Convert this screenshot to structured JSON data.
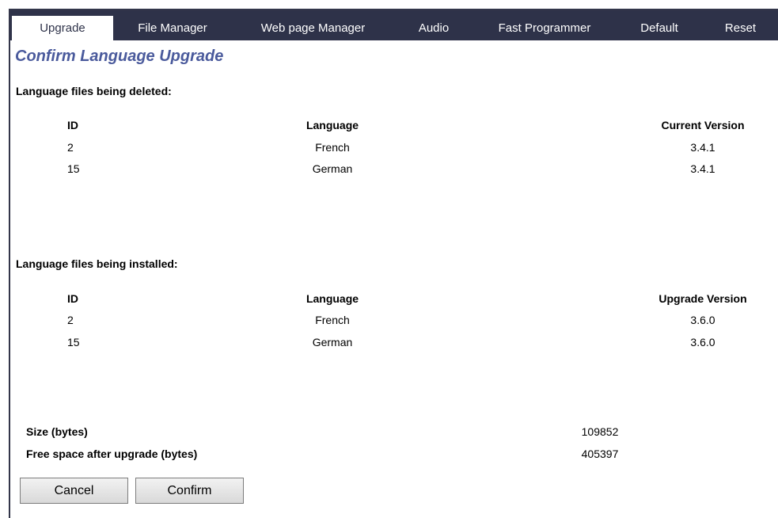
{
  "tabs": [
    {
      "label": "Upgrade",
      "active": true
    },
    {
      "label": "File Manager",
      "active": false
    },
    {
      "label": "Web page Manager",
      "active": false
    },
    {
      "label": "Audio",
      "active": false
    },
    {
      "label": "Fast Programmer",
      "active": false
    },
    {
      "label": "Default",
      "active": false
    },
    {
      "label": "Reset",
      "active": false
    }
  ],
  "page": {
    "title": "Confirm Language Upgrade"
  },
  "deleted": {
    "heading": "Language files being deleted:",
    "columns": {
      "id": "ID",
      "language": "Language",
      "version": "Current Version"
    },
    "rows": [
      {
        "id": "2",
        "language": "French",
        "version": "3.4.1"
      },
      {
        "id": "15",
        "language": "German",
        "version": "3.4.1"
      }
    ]
  },
  "installed": {
    "heading": "Language files being installed:",
    "columns": {
      "id": "ID",
      "language": "Language",
      "version": "Upgrade Version"
    },
    "rows": [
      {
        "id": "2",
        "language": "French",
        "version": "3.6.0"
      },
      {
        "id": "15",
        "language": "German",
        "version": "3.6.0"
      }
    ]
  },
  "summary": {
    "size_label": "Size (bytes)",
    "size_value": "109852",
    "free_label": "Free space after upgrade (bytes)",
    "free_value": "405397"
  },
  "buttons": {
    "cancel": "Cancel",
    "confirm": "Confirm"
  },
  "colors": {
    "tabbar": "#2e3249",
    "title": "#4a5a9c"
  }
}
